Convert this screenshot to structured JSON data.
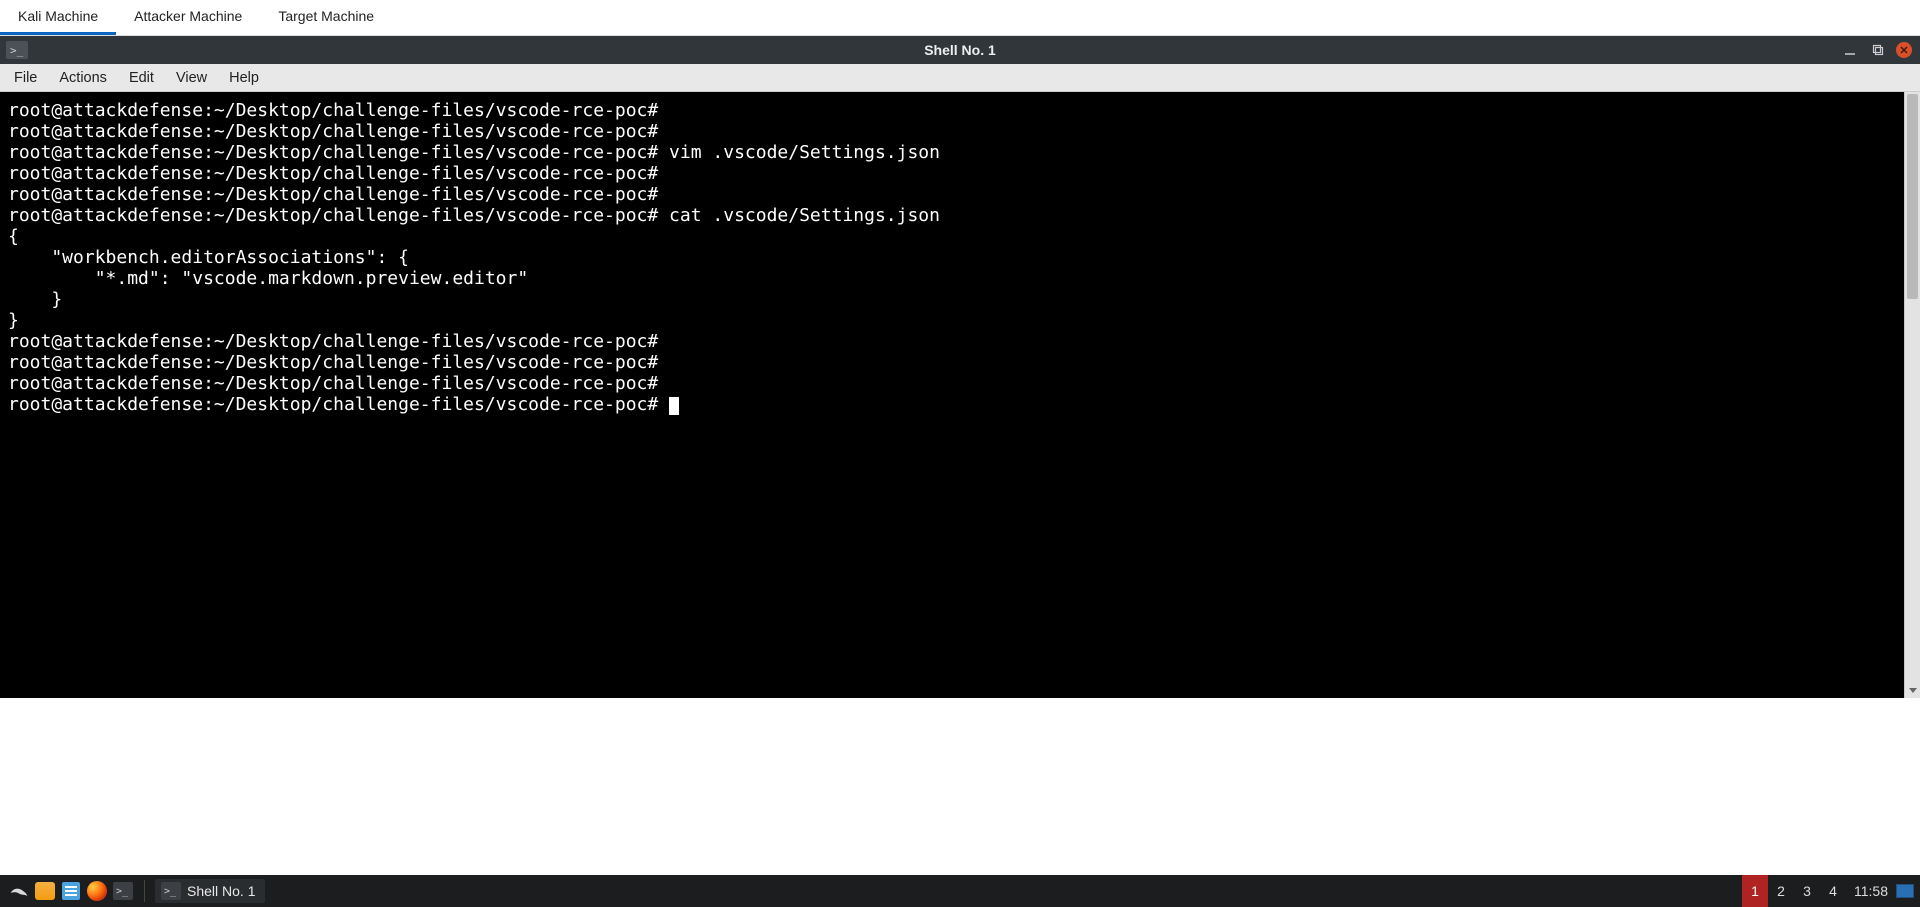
{
  "tabs": {
    "items": [
      {
        "label": "Kali Machine",
        "active": true
      },
      {
        "label": "Attacker Machine",
        "active": false
      },
      {
        "label": "Target Machine",
        "active": false
      }
    ]
  },
  "window": {
    "title": "Shell No. 1",
    "icon_text": ">_"
  },
  "menubar": {
    "items": [
      "File",
      "Actions",
      "Edit",
      "View",
      "Help"
    ]
  },
  "terminal": {
    "lines": [
      "root@attackdefense:~/Desktop/challenge-files/vscode-rce-poc#",
      "root@attackdefense:~/Desktop/challenge-files/vscode-rce-poc#",
      "root@attackdefense:~/Desktop/challenge-files/vscode-rce-poc# vim .vscode/Settings.json",
      "root@attackdefense:~/Desktop/challenge-files/vscode-rce-poc#",
      "root@attackdefense:~/Desktop/challenge-files/vscode-rce-poc#",
      "root@attackdefense:~/Desktop/challenge-files/vscode-rce-poc# cat .vscode/Settings.json",
      "{",
      "    \"workbench.editorAssociations\": {",
      "        \"*.md\": \"vscode.markdown.preview.editor\"",
      "    }",
      "}",
      "root@attackdefense:~/Desktop/challenge-files/vscode-rce-poc#",
      "root@attackdefense:~/Desktop/challenge-files/vscode-rce-poc#",
      "root@attackdefense:~/Desktop/challenge-files/vscode-rce-poc#",
      "root@attackdefense:~/Desktop/challenge-files/vscode-rce-poc# "
    ]
  },
  "taskbar": {
    "task_label": "Shell No. 1",
    "task_icon_text": ">_",
    "launcher_icon_text": ">_",
    "workspaces": [
      "1",
      "2",
      "3",
      "4"
    ],
    "active_workspace": "1",
    "clock": "11:58"
  }
}
